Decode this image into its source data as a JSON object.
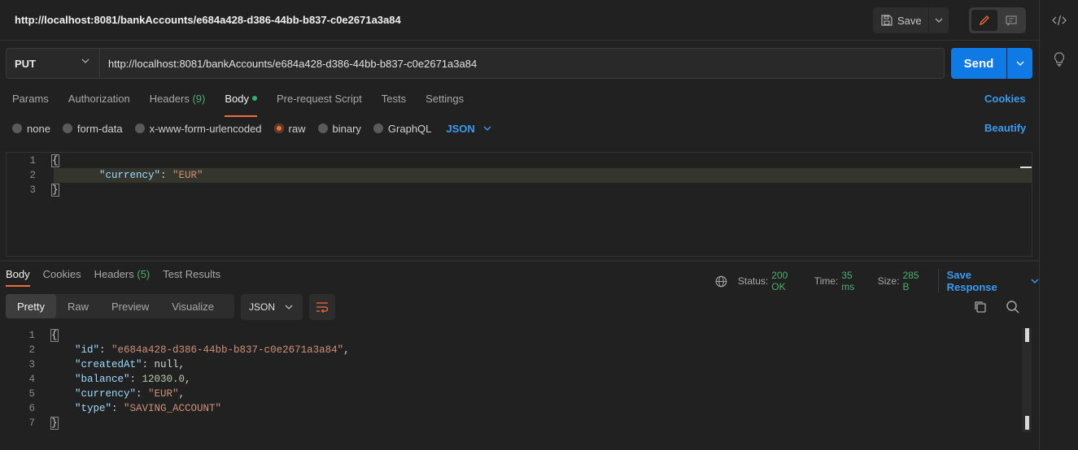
{
  "title": "http://localhost:8081/bankAccounts/e684a428-d386-44bb-b837-c0e2671a3a84",
  "toolbar": {
    "save_label": "Save"
  },
  "request": {
    "method": "PUT",
    "url": "http://localhost:8081/bankAccounts/e684a428-d386-44bb-b837-c0e2671a3a84",
    "send_label": "Send",
    "tabs": [
      {
        "label": "Params"
      },
      {
        "label": "Authorization"
      },
      {
        "label": "Headers",
        "count": "(9)"
      },
      {
        "label": "Body",
        "active": true
      },
      {
        "label": "Pre-request Script"
      },
      {
        "label": "Tests"
      },
      {
        "label": "Settings"
      }
    ],
    "cookies_label": "Cookies",
    "body_types": [
      "none",
      "form-data",
      "x-www-form-urlencoded",
      "raw",
      "binary",
      "GraphQL"
    ],
    "selected_body_type": "raw",
    "format": "JSON",
    "beautify_label": "Beautify",
    "body_lines": [
      {
        "n": "1",
        "text": "{"
      },
      {
        "n": "2",
        "key": "\"currency\"",
        "value": "\"EUR\""
      },
      {
        "n": "3",
        "text": "}"
      }
    ]
  },
  "response": {
    "tabs": [
      {
        "label": "Body",
        "active": true
      },
      {
        "label": "Cookies"
      },
      {
        "label": "Headers",
        "count": "(5)"
      },
      {
        "label": "Test Results"
      }
    ],
    "status_label": "Status:",
    "status_value": "200 OK",
    "time_label": "Time:",
    "time_value": "35 ms",
    "size_label": "Size:",
    "size_value": "285 B",
    "save_response_label": "Save Response",
    "views": [
      "Pretty",
      "Raw",
      "Preview",
      "Visualize"
    ],
    "active_view": "Pretty",
    "format": "JSON",
    "lines": [
      {
        "n": "1",
        "text": "{"
      },
      {
        "n": "2",
        "key": "\"id\"",
        "value": "\"e684a428-d386-44bb-b837-c0e2671a3a84\"",
        "type": "str",
        "comma": ","
      },
      {
        "n": "3",
        "key": "\"createdAt\"",
        "value": "null",
        "type": "kw",
        "comma": ","
      },
      {
        "n": "4",
        "key": "\"balance\"",
        "value": "12030.0",
        "type": "num",
        "comma": ","
      },
      {
        "n": "5",
        "key": "\"currency\"",
        "value": "\"EUR\"",
        "type": "str",
        "comma": ","
      },
      {
        "n": "6",
        "key": "\"type\"",
        "value": "\"SAVING_ACCOUNT\"",
        "type": "str",
        "comma": ""
      },
      {
        "n": "7",
        "text": "}"
      }
    ]
  },
  "colors": {
    "accent": "#f26b3a",
    "primary": "#0f7ae5",
    "link": "#3a9bf0",
    "success": "#49b16c"
  }
}
